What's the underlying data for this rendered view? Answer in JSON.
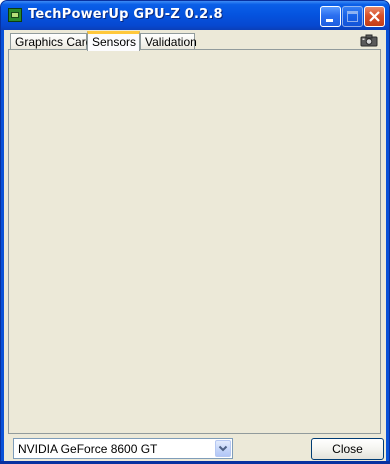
{
  "window": {
    "title": "TechPowerUp GPU-Z 0.2.8"
  },
  "title_buttons": {
    "minimize_icon": "minimize-icon",
    "maximize_icon": "maximize-icon",
    "close_icon": "close-icon"
  },
  "tabs": [
    {
      "label": "Graphics Card",
      "active": false
    },
    {
      "label": "Sensors",
      "active": true
    },
    {
      "label": "Validation",
      "active": false
    }
  ],
  "toolbar": {
    "screenshot_icon": "camera-icon"
  },
  "footer": {
    "gpu_selected": "NVIDIA GeForce 8600 GT",
    "close_label": "Close"
  },
  "colors": {
    "titlebar": "#0554e0",
    "client_bg": "#ece9d8",
    "active_tab_accent": "#ffc83c"
  }
}
